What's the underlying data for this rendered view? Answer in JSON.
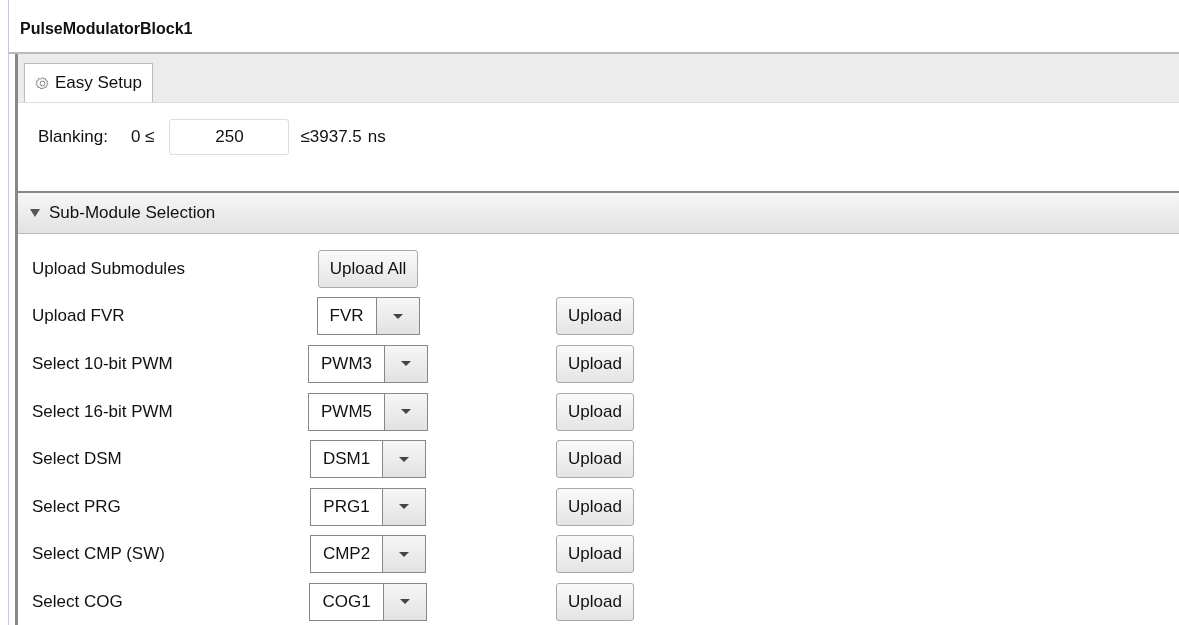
{
  "window": {
    "title": "PulseModulatorBlock1"
  },
  "tabs": [
    {
      "label": "Easy Setup",
      "selected": true
    }
  ],
  "blanking": {
    "label": "Blanking:",
    "min": "0 ≤",
    "value": "250",
    "max": "≤3937.5",
    "unit": "ns"
  },
  "section": {
    "title": "Sub-Module Selection",
    "expanded": true
  },
  "rows": [
    {
      "kind": "button",
      "label": "Upload Submodules",
      "button": "Upload All"
    },
    {
      "kind": "select",
      "label": "Upload FVR",
      "value": "FVR",
      "button": "Upload"
    },
    {
      "kind": "select",
      "label": "Select 10-bit PWM",
      "value": "PWM3",
      "button": "Upload"
    },
    {
      "kind": "select",
      "label": "Select 16-bit PWM",
      "value": "PWM5",
      "button": "Upload"
    },
    {
      "kind": "select",
      "label": "Select DSM",
      "value": "DSM1",
      "button": "Upload"
    },
    {
      "kind": "select",
      "label": "Select PRG",
      "value": "PRG1",
      "button": "Upload"
    },
    {
      "kind": "select",
      "label": "Select CMP (SW)",
      "value": "CMP2",
      "button": "Upload"
    },
    {
      "kind": "select",
      "label": "Select COG",
      "value": "COG1",
      "button": "Upload"
    }
  ]
}
